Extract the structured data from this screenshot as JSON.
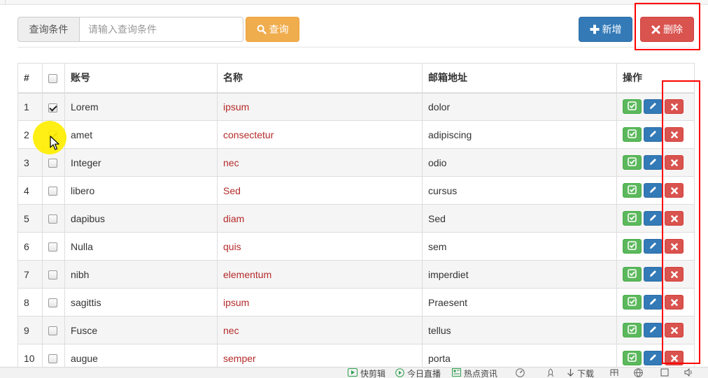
{
  "search": {
    "addon_label": "查询条件",
    "placeholder": "请输入查询条件",
    "value": "",
    "query_label": "查询"
  },
  "actions": {
    "add_label": "新增",
    "delete_label": "删除"
  },
  "table": {
    "headers": {
      "index": "#",
      "account": "账号",
      "name": "名称",
      "email": "邮箱地址",
      "ops": "操作"
    },
    "rows": [
      {
        "index": "1",
        "checked": true,
        "account": "Lorem",
        "name": "ipsum",
        "email": "dolor"
      },
      {
        "index": "2",
        "checked": true,
        "account": "amet",
        "name": "consectetur",
        "email": "adipiscing"
      },
      {
        "index": "3",
        "checked": false,
        "account": "Integer",
        "name": "nec",
        "email": "odio"
      },
      {
        "index": "4",
        "checked": false,
        "account": "libero",
        "name": "Sed",
        "email": "cursus"
      },
      {
        "index": "5",
        "checked": false,
        "account": "dapibus",
        "name": "diam",
        "email": "Sed"
      },
      {
        "index": "6",
        "checked": false,
        "account": "Nulla",
        "name": "quis",
        "email": "sem"
      },
      {
        "index": "7",
        "checked": false,
        "account": "nibh",
        "name": "elementum",
        "email": "imperdiet"
      },
      {
        "index": "8",
        "checked": false,
        "account": "sagittis",
        "name": "ipsum",
        "email": "Praesent"
      },
      {
        "index": "9",
        "checked": false,
        "account": "Fusce",
        "name": "nec",
        "email": "tellus"
      },
      {
        "index": "10",
        "checked": false,
        "account": "augue",
        "name": "semper",
        "email": "porta"
      }
    ],
    "row_ops_icons": [
      "check-square-icon",
      "pencil-icon",
      "times-icon"
    ]
  },
  "statusbar": {
    "items": [
      "快剪辑",
      "今日直播",
      "热点资讯",
      "下载"
    ]
  },
  "colors": {
    "primary": "#337ab7",
    "success": "#5cb85c",
    "warning": "#f0ad4e",
    "danger": "#d9534f",
    "name_text": "#b52a2a",
    "annotation": "#ff0000",
    "cursor_halo": "#ffee00"
  }
}
